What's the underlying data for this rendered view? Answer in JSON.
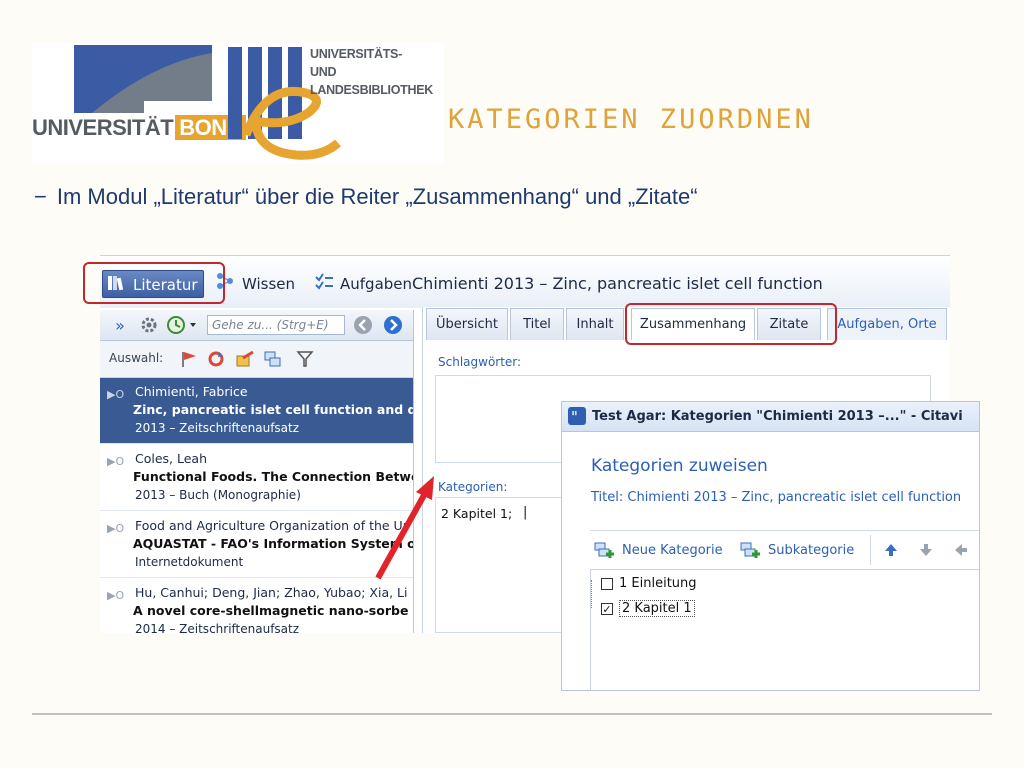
{
  "logo": {
    "university": "UNIVERSITÄT",
    "city": "BONN",
    "library_line1": "UNIVERSITÄTS-",
    "library_line2": "UND LANDESBIBLIOTHEK"
  },
  "slide": {
    "title": "KATEGORIEN ZUORDNEN",
    "bullet_marker": "−",
    "bullet": "Im Modul „Literatur“ über die Reiter „Zusammenhang“ und „Zitate“"
  },
  "app": {
    "nav": {
      "literatur": "Literatur",
      "wissen": "Wissen",
      "aufgaben": "Aufgaben"
    },
    "header_title": "Chimienti 2013 – Zinc, pancreatic islet cell function",
    "toolbar": {
      "expand": "»",
      "goto_placeholder": "Gehe zu... (Strg+E)",
      "auswahl_label": "Auswahl:"
    },
    "records": [
      {
        "author": "Chimienti, Fabrice",
        "title": "Zinc, pancreatic islet cell function and di",
        "meta": "2013 – Zeitschriftenaufsatz"
      },
      {
        "author": "Coles, Leah",
        "title": "Functional Foods. The Connection Betwe",
        "meta": "2013 – Buch (Monographie)"
      },
      {
        "author": "Food and Agriculture Organization of the Ur",
        "title": "AQUASTAT - FAO's Information System o",
        "meta": "Internetdokument"
      },
      {
        "author": "Hu, Canhui; Deng, Jian; Zhao, Yubao; Xia, Li",
        "title": "A novel core-shellmagnetic nano-sorbe",
        "meta": "2014 – Zeitschriftenaufsatz"
      }
    ],
    "tabs": {
      "uebersicht": "Übersicht",
      "titel": "Titel",
      "inhalt": "Inhalt",
      "zusammenhang": "Zusammenhang",
      "zitate": "Zitate",
      "aufgaben_orte": "Aufgaben, Orte"
    },
    "fields": {
      "schlagwoerter_label": "Schlagwörter:",
      "kategorien_label": "Kategorien:",
      "kategorien_value": "2 Kapitel 1;"
    }
  },
  "dialog": {
    "title": "Test Agar: Kategorien \"Chimienti 2013 –...\" - Citavi",
    "heading": "Kategorien zuweisen",
    "subtitle": "Titel: Chimienti 2013 – Zinc, pancreatic islet cell function",
    "buttons": {
      "new_category": "Neue Kategorie",
      "subcategory": "Subkategorie"
    },
    "tree": [
      {
        "label": "1 Einleitung",
        "checked": false
      },
      {
        "label": "2 Kapitel 1",
        "checked": true
      }
    ]
  },
  "colors": {
    "title_accent": "#e0a33a",
    "bullet_text": "#1f3a6e",
    "highlight_box": "#c0282d",
    "selection_bg": "#3a5a93",
    "link_blue": "#2b5fb6"
  }
}
